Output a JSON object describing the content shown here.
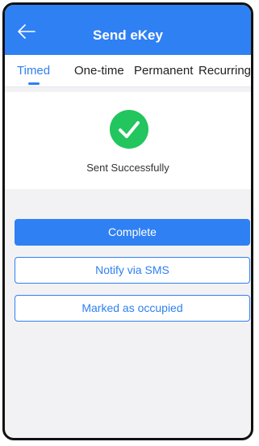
{
  "header": {
    "title": "Send eKey",
    "back_icon": "arrow-left-icon",
    "background_color": "#2f80f3"
  },
  "tabs": [
    {
      "label": "Timed",
      "active": true
    },
    {
      "label": "One-time",
      "active": false
    },
    {
      "label": "Permanent",
      "active": false
    },
    {
      "label": "Recurring",
      "active": false
    }
  ],
  "result": {
    "icon": "success-check-icon",
    "icon_color": "#22c55e",
    "message": "Sent Successfully"
  },
  "actions": {
    "complete_label": "Complete",
    "notify_sms_label": "Notify via SMS",
    "mark_occupied_label": "Marked as occupied"
  },
  "colors": {
    "accent": "#2f80f3",
    "page_background": "#f2f2f5"
  }
}
